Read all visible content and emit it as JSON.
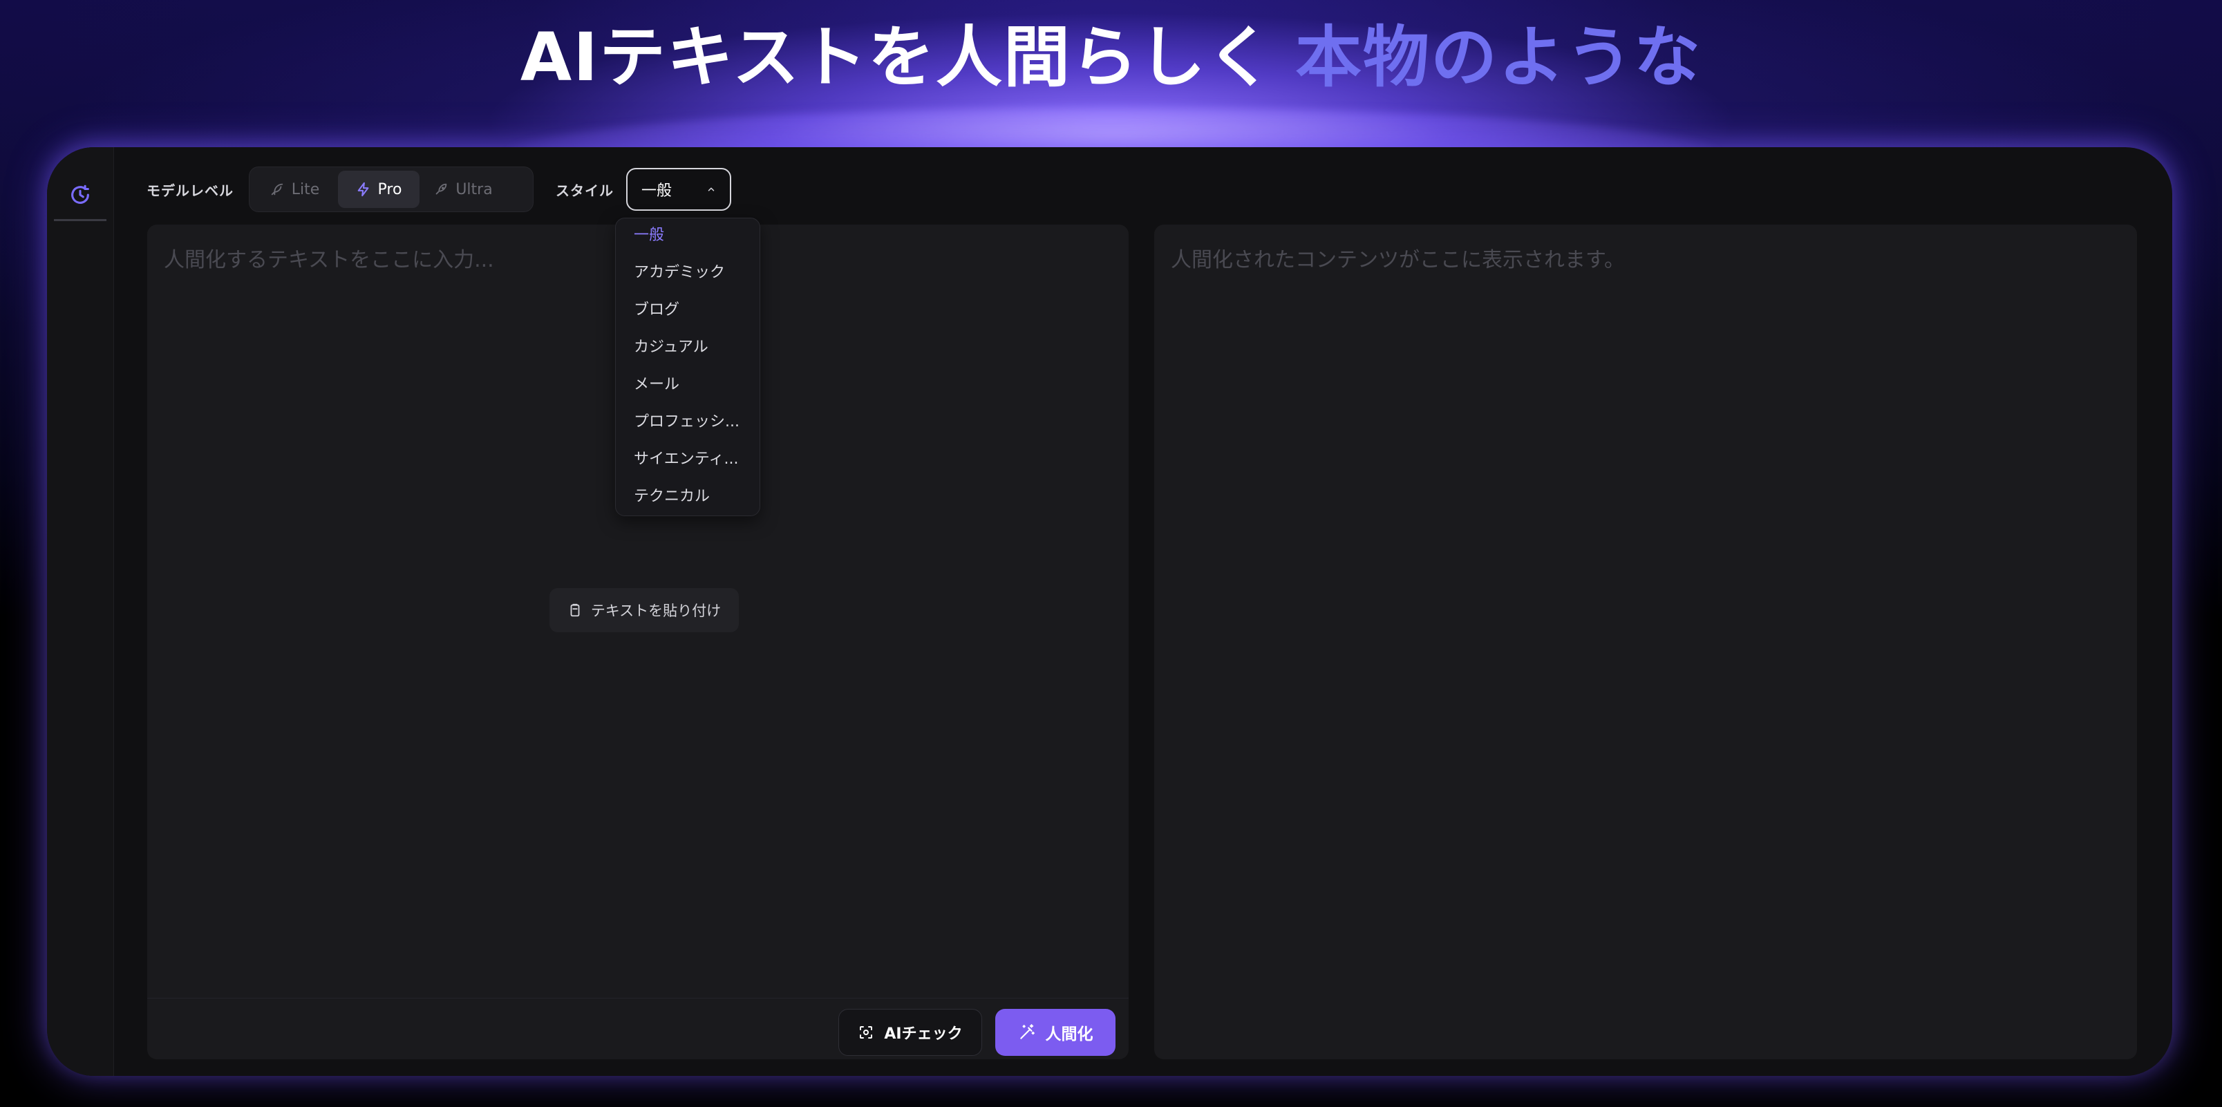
{
  "hero": {
    "title_white": "AIテキストを人間らしく",
    "title_purple": "本物のような"
  },
  "sidebar": {
    "history_icon": "history-icon"
  },
  "toolbar": {
    "model_level_label": "モデルレベル",
    "models": [
      {
        "label": "Lite",
        "icon": "feather-icon",
        "active": false
      },
      {
        "label": "Pro",
        "icon": "lightning-icon",
        "active": true
      },
      {
        "label": "Ultra",
        "icon": "rocket-icon",
        "active": false
      }
    ],
    "style_label": "スタイル",
    "style_selected": "一般"
  },
  "style_dropdown": {
    "options": [
      "一般",
      "アカデミック",
      "ブログ",
      "カジュアル",
      "メール",
      "プロフェッシ...",
      "サイエンティ...",
      "テクニカル"
    ],
    "selected_index": 0
  },
  "input_panel": {
    "placeholder": "人間化するテキストをここに入力...",
    "paste_label": "テキストを貼り付け",
    "ai_check_label": "AIチェック",
    "humanize_label": "人間化"
  },
  "output_panel": {
    "placeholder": "人間化されたコンテンツがここに表示されます。"
  },
  "colors": {
    "accent": "#7c5cf0",
    "accent_light": "#6f6ff0",
    "panel_bg": "#1a1a1d",
    "card_bg": "#101012"
  }
}
